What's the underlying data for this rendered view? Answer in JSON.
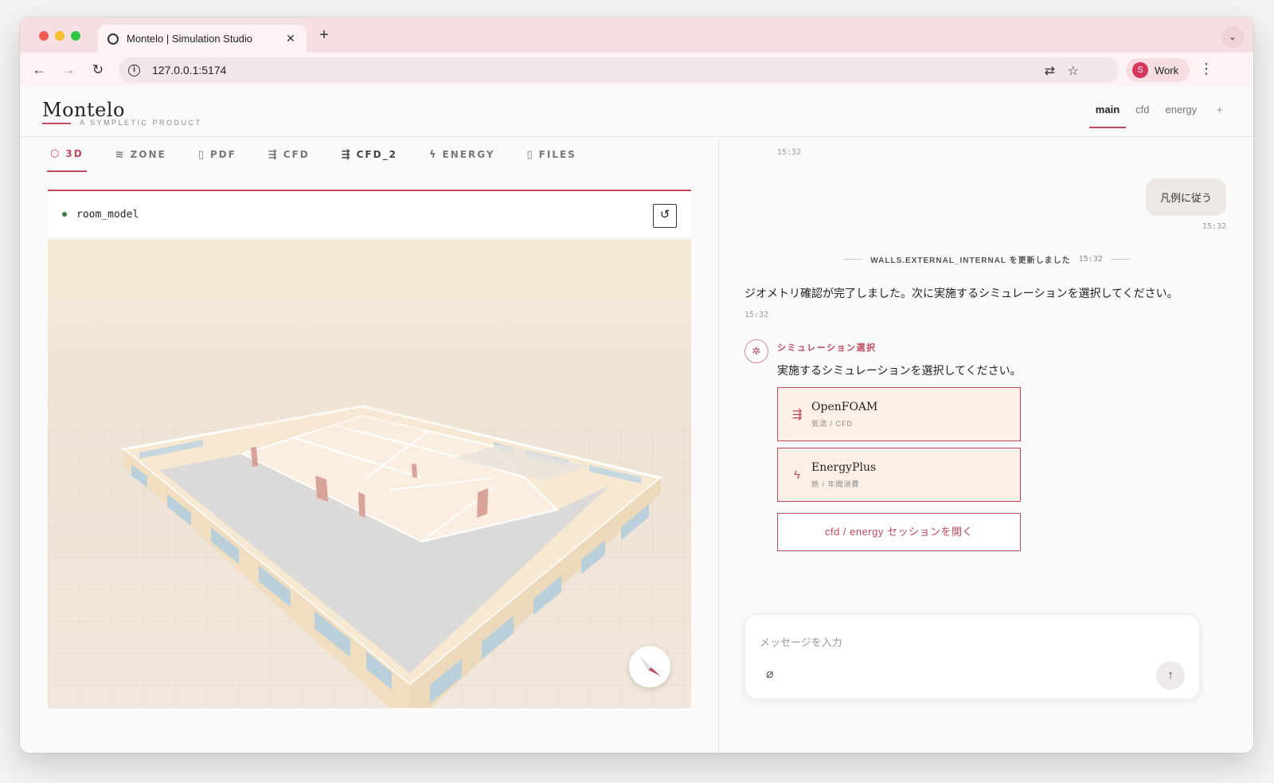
{
  "browser": {
    "tab_title": "Montelo | Simulation Studio",
    "tab_close": "✕",
    "new_tab": "+",
    "url": "127.0.0.1:5174",
    "profile_initial": "S",
    "profile_label": "Work"
  },
  "app": {
    "logo": "Montelo",
    "tagline": "A SYMPLETIC PRODUCT",
    "sessions": [
      "main",
      "cfd",
      "energy"
    ],
    "active_session": "main",
    "add_session": "+"
  },
  "view_tabs": [
    {
      "label": "3D",
      "icon": "cube-icon",
      "active": true
    },
    {
      "label": "ZONE",
      "icon": "layers-icon"
    },
    {
      "label": "PDF",
      "icon": "document-icon"
    },
    {
      "label": "CFD",
      "icon": "flow-icon"
    },
    {
      "label": "CFD_2",
      "icon": "flow-icon"
    },
    {
      "label": "ENERGY",
      "icon": "bolt-icon"
    },
    {
      "label": "FILES",
      "icon": "document-icon"
    }
  ],
  "viewer": {
    "model_name": "room_model",
    "status_color": "#3d7a4a"
  },
  "chat": {
    "top_time": "15:32",
    "user_message": "凡例に従う",
    "user_time": "15:32",
    "system_text": "WALLS.EXTERNAL_INTERNAL を更新しました",
    "system_time": "15:32",
    "assistant_message": "ジオメトリ確認が完了しました。次に実施するシミュレーションを選択してください。",
    "assistant_time": "15:32",
    "tool_title": "シミュレーション選択",
    "tool_desc": "実施するシミュレーションを選択してください。",
    "options": [
      {
        "name": "OpenFOAM",
        "sub": "気流 / CFD",
        "icon": "flow-icon"
      },
      {
        "name": "EnergyPlus",
        "sub": "熱 / 年間消費",
        "icon": "bolt-icon"
      }
    ],
    "open_session_label": "cfd / energy セッションを開く",
    "composer_placeholder": "メッセージを入力"
  },
  "colors": {
    "accent": "#c0485e",
    "tab_strip": "#f6dfe2"
  }
}
